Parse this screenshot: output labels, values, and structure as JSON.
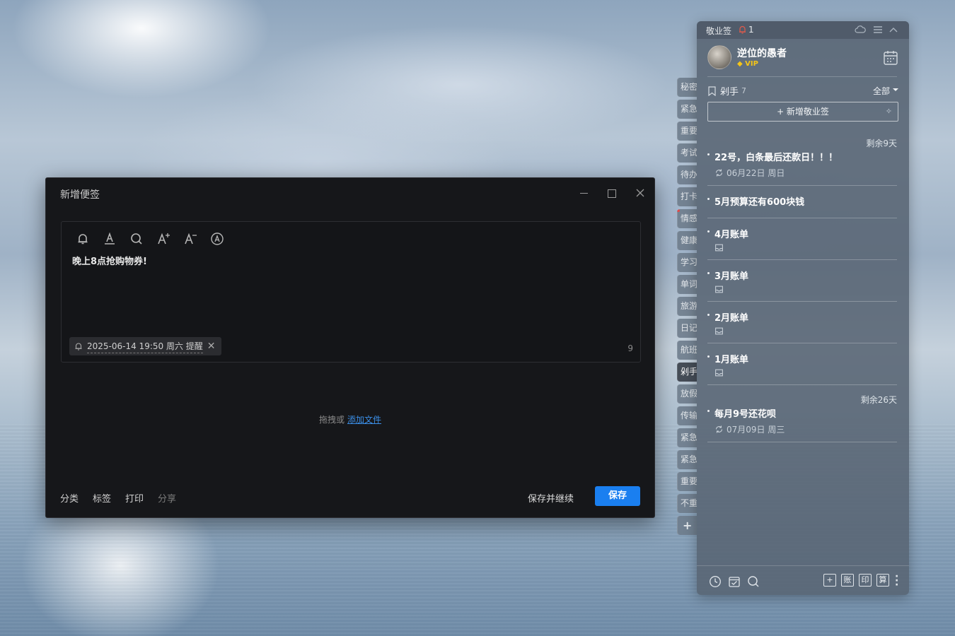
{
  "dialog": {
    "title": "新增便签",
    "note_text": "晚上8点抢购物券!",
    "reminder": "2025-06-14 19:50 周六 提醒",
    "char_count": "9",
    "drop_hint": "拖拽或",
    "add_file_link": "添加文件",
    "footer": {
      "category": "分类",
      "tag": "标签",
      "print": "打印",
      "share": "分享",
      "save_continue": "保存并继续",
      "save": "保存"
    },
    "toolbar_icons": [
      "bell-icon",
      "text-color-icon",
      "search-icon",
      "font-increase-icon",
      "font-decrease-icon",
      "text-style-icon"
    ]
  },
  "category_tabs": [
    {
      "label": "秘密"
    },
    {
      "label": "紧急"
    },
    {
      "label": "重要"
    },
    {
      "label": "考试"
    },
    {
      "label": "待办"
    },
    {
      "label": "打卡"
    },
    {
      "label": "情感"
    },
    {
      "label": "健康"
    },
    {
      "label": "学习"
    },
    {
      "label": "单词"
    },
    {
      "label": "旅游"
    },
    {
      "label": "日记"
    },
    {
      "label": "航班"
    },
    {
      "label": "剁手"
    },
    {
      "label": "放假"
    },
    {
      "label": "传输"
    },
    {
      "label": "紧急"
    },
    {
      "label": "紧急"
    },
    {
      "label": "重要"
    },
    {
      "label": "不重"
    }
  ],
  "category_add": "+",
  "panel": {
    "app_name": "敬业签",
    "bell_count": "1",
    "user": {
      "name": "逆位的愚者",
      "badge": "VIP"
    },
    "category": {
      "name": "剁手",
      "count": "7"
    },
    "filter": "全部",
    "new_note": "+ 新增敬业签",
    "notes": [
      {
        "days_left": "剩余9天",
        "title": "22号，白条最后还款日！！！",
        "date": "06月22日 周日"
      },
      {
        "title": "5月预算还有600块钱"
      },
      {
        "title": "4月账单"
      },
      {
        "title": "3月账单"
      },
      {
        "title": "2月账单"
      },
      {
        "title": "1月账单"
      },
      {
        "days_left": "剩余26天",
        "title": "每月9号还花呗",
        "date": "07月09日 周三"
      }
    ],
    "footer_boxes": [
      "+",
      "账",
      "印",
      "算"
    ]
  },
  "colors": {
    "accent": "#1a7ff0",
    "dialog_bg": "#16171a",
    "panel_bg": "#58647380",
    "alert": "#e35a4a",
    "vip": "#f5c518"
  }
}
